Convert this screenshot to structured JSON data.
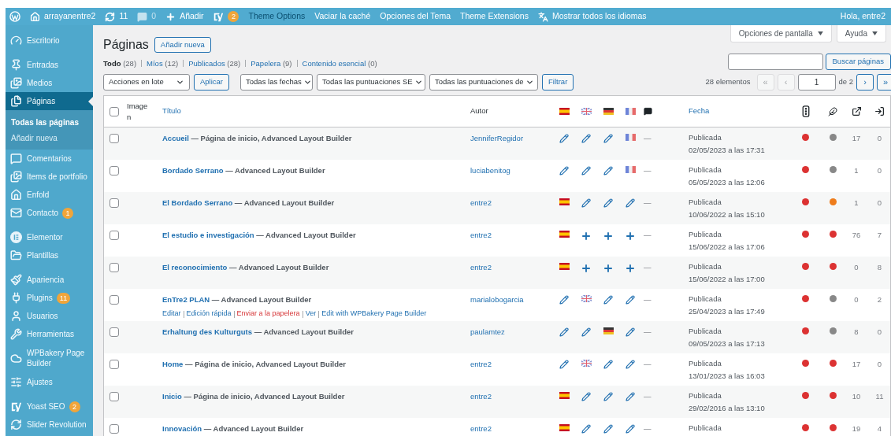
{
  "admin_bar": {
    "items": [
      {
        "kind": "site",
        "label": "arrayanentre2",
        "highlighted": false,
        "dimmed": false
      },
      {
        "kind": "updates",
        "label": "11",
        "highlighted": false,
        "dimmed": false
      },
      {
        "kind": "comments",
        "label": "0",
        "highlighted": false,
        "dimmed": true
      },
      {
        "kind": "new",
        "label": "Añadir",
        "highlighted": false,
        "dimmed": false
      },
      {
        "kind": "yoast",
        "badge": "2",
        "highlighted": false,
        "dimmed": false
      },
      {
        "kind": "link",
        "label": "Theme Options",
        "highlighted": true,
        "dimmed": false
      },
      {
        "kind": "link",
        "label": "Vaciar la caché",
        "highlighted": false,
        "dimmed": false
      },
      {
        "kind": "link",
        "label": "Opciones del Tema",
        "highlighted": false,
        "dimmed": false
      },
      {
        "kind": "link",
        "label": "Theme Extensions",
        "highlighted": false,
        "dimmed": false
      },
      {
        "kind": "languages",
        "label": "Mostrar todos los idiomas",
        "highlighted": false,
        "dimmed": false
      }
    ],
    "greeting": "Hola, entre2"
  },
  "sidebar": {
    "groups": [
      [
        {
          "label": "Escritorio",
          "selected": false
        }
      ],
      [
        {
          "label": "Entradas",
          "selected": false
        },
        {
          "label": "Medios",
          "selected": false
        },
        {
          "label": "Páginas",
          "selected": true,
          "children": [
            {
              "label": "Todas las páginas",
              "selected": true
            },
            {
              "label": "Añadir nueva",
              "selected": false
            }
          ]
        },
        {
          "label": "Comentarios",
          "selected": false
        },
        {
          "label": "Items de portfolio",
          "selected": false
        },
        {
          "label": "Enfold",
          "selected": false
        },
        {
          "label": "Contacto",
          "selected": false,
          "badge": "1"
        }
      ],
      [
        {
          "label": "Elementor",
          "selected": false
        },
        {
          "label": "Plantillas",
          "selected": false
        }
      ],
      [
        {
          "label": "Apariencia",
          "selected": false
        },
        {
          "label": "Plugins",
          "selected": false,
          "badge": "11"
        },
        {
          "label": "Usuarios",
          "selected": false
        },
        {
          "label": "Herramientas",
          "selected": false
        },
        {
          "label": "WPBakery Page Builder",
          "selected": false
        },
        {
          "label": "Ajustes",
          "selected": false
        }
      ],
      [
        {
          "label": "Yoast SEO",
          "selected": false,
          "badge": "2"
        },
        {
          "label": "Slider Revolution",
          "selected": false
        }
      ]
    ]
  },
  "screen_tabs": [
    "Opciones de pantalla",
    "Ayuda"
  ],
  "heading": "Páginas",
  "add_new": "Añadir nueva",
  "views": [
    {
      "label": "Todo",
      "count": "(28)",
      "selected": true
    },
    {
      "label": "Míos",
      "count": "(12)",
      "selected": false
    },
    {
      "label": "Publicados",
      "count": "(28)",
      "selected": false
    },
    {
      "label": "Papelera",
      "count": "(9)",
      "selected": false
    },
    {
      "label": "Contenido esencial",
      "count": "(0)",
      "selected": false
    }
  ],
  "search": {
    "button": "Buscar páginas"
  },
  "filters": {
    "bulk": "Acciones en lote",
    "apply": "Aplicar",
    "selects": [
      "Todas las fechas",
      "Todas las puntuaciones SE",
      "Todas las puntuaciones de"
    ],
    "filter": "Filtrar"
  },
  "pagination": {
    "count": "28 elementos",
    "first": {
      "label": "«",
      "disabled": true
    },
    "prev": {
      "label": "‹",
      "disabled": true
    },
    "page": "1",
    "total": "de 2",
    "next": {
      "label": "›",
      "disabled": false
    },
    "last": {
      "label": "»",
      "disabled": false
    }
  },
  "table": {
    "header": {
      "checked": false,
      "image": "Imagen",
      "title": "Título",
      "author": "Autor",
      "date": "Fecha",
      "languages": [
        {
          "kind": "es"
        },
        {
          "kind": "gb"
        },
        {
          "kind": "de"
        },
        {
          "kind": "fr"
        }
      ]
    },
    "rows": [
      {
        "checked": false,
        "title": "Accueil",
        "states": "— Página de inicio, Advanced Layout Builder",
        "author": "JenniferRegidor",
        "languages": [
          {
            "kind": "edit"
          },
          {
            "kind": "edit"
          },
          {
            "kind": "edit"
          },
          {
            "kind": "fr"
          }
        ],
        "comments": "—",
        "status": "Publicada",
        "date": "02/05/2023 a las 17:31",
        "scores": [
          {
            "color": "#dc3232"
          },
          {
            "color": "#888888"
          }
        ],
        "links": "17",
        "inlinks": "0"
      },
      {
        "checked": false,
        "title": "Bordado Serrano",
        "states": "— Advanced Layout Builder",
        "author": "luciabenitog",
        "languages": [
          {
            "kind": "edit"
          },
          {
            "kind": "edit"
          },
          {
            "kind": "edit"
          },
          {
            "kind": "fr"
          }
        ],
        "comments": "—",
        "status": "Publicada",
        "date": "05/05/2023 a las 12:06",
        "scores": [
          {
            "color": "#dc3232"
          },
          {
            "color": "#888888"
          }
        ],
        "links": "1",
        "inlinks": "0"
      },
      {
        "checked": false,
        "title": "El Bordado Serrano",
        "states": "— Advanced Layout Builder",
        "author": "entre2",
        "languages": [
          {
            "kind": "es"
          },
          {
            "kind": "edit"
          },
          {
            "kind": "edit"
          },
          {
            "kind": "edit"
          }
        ],
        "comments": "—",
        "status": "Publicada",
        "date": "10/06/2022 a las 15:10",
        "scores": [
          {
            "color": "#dc3232"
          },
          {
            "color": "#ee7c1b"
          }
        ],
        "links": "1",
        "inlinks": "0"
      },
      {
        "checked": false,
        "title": "El estudio e investigación",
        "states": "— Advanced Layout Builder",
        "author": "entre2",
        "languages": [
          {
            "kind": "es"
          },
          {
            "kind": "add"
          },
          {
            "kind": "add"
          },
          {
            "kind": "add"
          }
        ],
        "comments": "—",
        "status": "Publicada",
        "date": "15/06/2022 a las 17:06",
        "scores": [
          {
            "color": "#dc3232"
          },
          {
            "color": "#dc3232"
          }
        ],
        "links": "76",
        "inlinks": "7"
      },
      {
        "checked": false,
        "title": "El reconocimiento",
        "states": "— Advanced Layout Builder",
        "author": "entre2",
        "languages": [
          {
            "kind": "es"
          },
          {
            "kind": "add"
          },
          {
            "kind": "add"
          },
          {
            "kind": "add"
          }
        ],
        "comments": "—",
        "status": "Publicada",
        "date": "15/06/2022 a las 17:00",
        "scores": [
          {
            "color": "#dc3232"
          },
          {
            "color": "#dc3232"
          }
        ],
        "links": "0",
        "inlinks": "8"
      },
      {
        "checked": false,
        "title": "EnTre2 PLAN",
        "states": "— Advanced Layout Builder",
        "author": "marialobogarcia",
        "languages": [
          {
            "kind": "edit"
          },
          {
            "kind": "gb"
          },
          {
            "kind": "edit"
          },
          {
            "kind": "edit"
          }
        ],
        "comments": "—",
        "status": "Publicada",
        "date": "25/04/2023 a las 17:49",
        "scores": [
          {
            "color": "#dc3232"
          },
          {
            "color": "#888888"
          }
        ],
        "links": "0",
        "inlinks": "2",
        "actions": [
          {
            "kind": "link",
            "label": "Editar"
          },
          {
            "kind": "link",
            "label": "Edición rápida"
          },
          {
            "kind": "delete",
            "label": "Enviar a la papelera"
          },
          {
            "kind": "link",
            "label": "Ver"
          },
          {
            "kind": "link",
            "label": "Edit with WPBakery Page Builder"
          }
        ]
      },
      {
        "checked": false,
        "title": "Erhaltung des Kulturguts",
        "states": "— Advanced Layout Builder",
        "author": "paulamtez",
        "languages": [
          {
            "kind": "edit"
          },
          {
            "kind": "edit"
          },
          {
            "kind": "de"
          },
          {
            "kind": "edit"
          }
        ],
        "comments": "—",
        "status": "Publicada",
        "date": "09/05/2023 a las 17:13",
        "scores": [
          {
            "color": "#dc3232"
          },
          {
            "color": "#888888"
          }
        ],
        "links": "8",
        "inlinks": "0"
      },
      {
        "checked": false,
        "title": "Home",
        "states": "— Página de inicio, Advanced Layout Builder",
        "author": "entre2",
        "languages": [
          {
            "kind": "edit"
          },
          {
            "kind": "gb"
          },
          {
            "kind": "edit"
          },
          {
            "kind": "edit"
          }
        ],
        "comments": "—",
        "status": "Publicada",
        "date": "13/01/2023 a las 16:03",
        "scores": [
          {
            "color": "#dc3232"
          },
          {
            "color": "#dc3232"
          }
        ],
        "links": "17",
        "inlinks": "0"
      },
      {
        "checked": false,
        "title": "Inicio",
        "states": "— Página de inicio, Advanced Layout Builder",
        "author": "entre2",
        "languages": [
          {
            "kind": "es"
          },
          {
            "kind": "edit"
          },
          {
            "kind": "edit"
          },
          {
            "kind": "edit"
          }
        ],
        "comments": "—",
        "status": "Publicada",
        "date": "29/02/2016 a las 13:10",
        "scores": [
          {
            "color": "#dc3232"
          },
          {
            "color": "#dc3232"
          }
        ],
        "links": "10",
        "inlinks": "11"
      },
      {
        "checked": false,
        "title": "Innovación",
        "states": "— Advanced Layout Builder",
        "author": "entre2",
        "languages": [
          {
            "kind": "es"
          },
          {
            "kind": "edit"
          },
          {
            "kind": "edit"
          },
          {
            "kind": "edit"
          }
        ],
        "comments": "—",
        "status": "Publicada",
        "scores": [
          {
            "color": "#dc3232"
          },
          {
            "color": "#dc3232"
          }
        ],
        "links": "19",
        "inlinks": "4"
      }
    ]
  }
}
